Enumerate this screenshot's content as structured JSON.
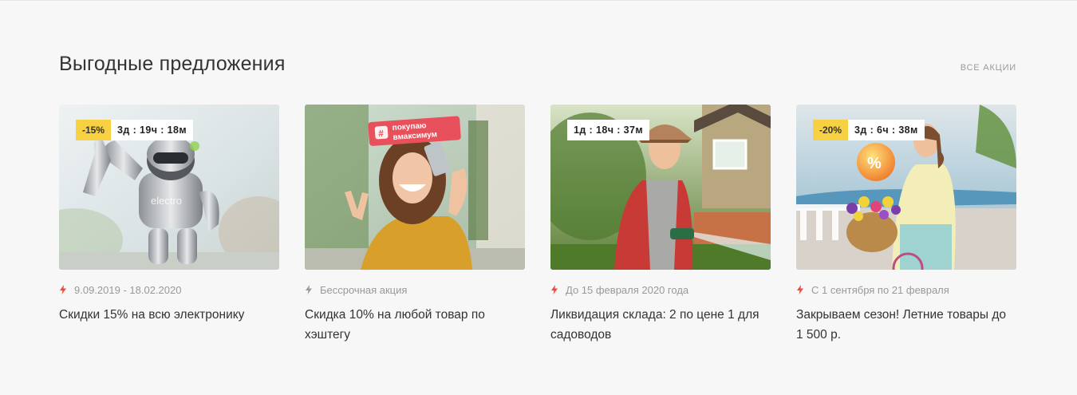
{
  "section": {
    "title": "Выгодные предложения",
    "all_link": "ВСЕ АКЦИИ"
  },
  "colors": {
    "accent_red": "#e94b3c",
    "badge_yellow": "#f8d142",
    "muted_grey": "#999999",
    "bolt_grey": "#9a9a9a"
  },
  "cards": [
    {
      "discount": "-15%",
      "timer": "3д : 19ч : 18м",
      "date": "9.09.2019 - 18.02.2020",
      "title": "Скидки 15% на всю электронику",
      "bolt_color": "red",
      "image": "robot-photo"
    },
    {
      "sticker": "# покупаю вмаксимум",
      "date": "Бессрочная акция",
      "title": "Скидка 10% на любой товар по хэштегу",
      "bolt_color": "grey",
      "image": "selfie-woman-photo"
    },
    {
      "timer": "1д : 18ч : 37м",
      "date": "До 15 февраля 2020 года",
      "title": "Ликвидация склада: 2 по цене 1 для садоводов",
      "bolt_color": "red",
      "image": "gardener-woman-photo"
    },
    {
      "discount": "-20%",
      "timer": "3д : 6ч : 38м",
      "date": "С 1 сентября по 21 февраля",
      "title": "Закрываем сезон! Летние товары до 1 500 р.",
      "bolt_color": "red",
      "image": "bicycle-woman-photo"
    }
  ]
}
